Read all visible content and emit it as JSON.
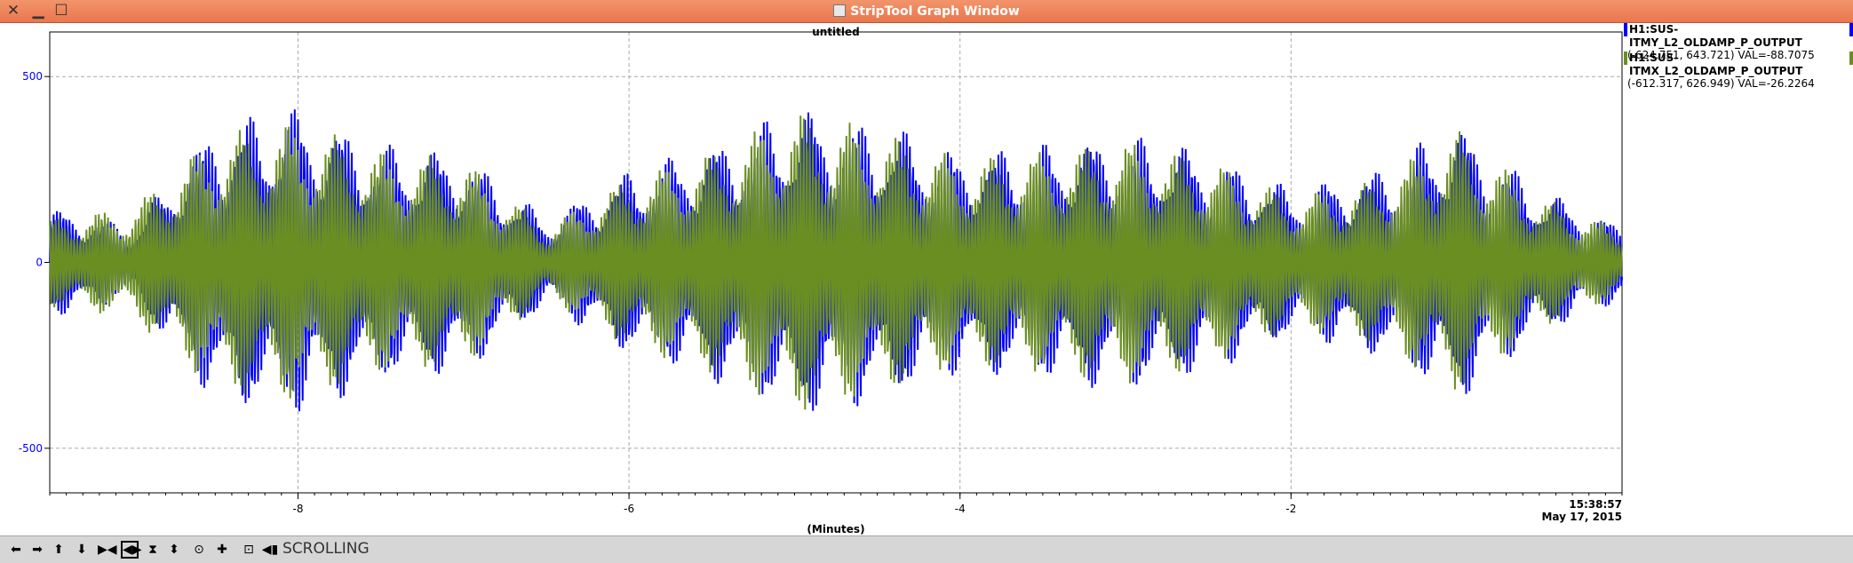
{
  "window": {
    "title": "StripTool Graph Window"
  },
  "graph": {
    "title": "untitled",
    "xlabel": "(Minutes)",
    "timestamp": {
      "time": "15:38:57",
      "date": "May 17, 2015"
    },
    "y_ticks": [
      "500",
      "0",
      "-500"
    ],
    "x_ticks": [
      "-8",
      "-6",
      "-4",
      "-2"
    ]
  },
  "legend": [
    {
      "name": "H1:SUS-ITMY_L2_OLDAMP_P_OUTPUT",
      "range": "(-624.751, 643.721) VAL=-88.7075",
      "color": "#0000ff"
    },
    {
      "name": "H1:SUS-ITMX_L2_OLDAMP_P_OUTPUT",
      "range": "(-612.317, 626.949) VAL=-26.2264",
      "color": "#6b8e23"
    }
  ],
  "toolbar": {
    "mode_label": "SCROLLING"
  },
  "chart_data": {
    "type": "line",
    "title": "untitled",
    "xlabel": "(Minutes)",
    "ylabel": "",
    "xlim": [
      -9.5,
      0
    ],
    "ylim": [
      -620,
      620
    ],
    "grid": true,
    "series": [
      {
        "name": "H1:SUS-ITMY_L2_OLDAMP_P_OUTPUT",
        "color": "#0000ff",
        "envelope": {
          "x": [
            -9.5,
            -9.0,
            -8.5,
            -8.0,
            -7.5,
            -7.0,
            -6.5,
            -6.0,
            -5.5,
            -5.0,
            -4.5,
            -4.0,
            -3.5,
            -3.0,
            -2.5,
            -2.0,
            -1.5,
            -1.0,
            -0.5,
            0.0
          ],
          "y": [
            150,
            100,
            380,
            420,
            320,
            300,
            120,
            250,
            320,
            420,
            380,
            300,
            320,
            350,
            300,
            200,
            250,
            380,
            200,
            100
          ]
        }
      },
      {
        "name": "H1:SUS-ITMX_L2_OLDAMP_P_OUTPUT",
        "color": "#6b8e23",
        "envelope": {
          "x": [
            -9.5,
            -9.0,
            -8.5,
            -8.0,
            -7.5,
            -7.0,
            -6.5,
            -6.0,
            -5.5,
            -5.0,
            -4.5,
            -4.0,
            -3.5,
            -3.0,
            -2.5,
            -2.0,
            -1.5,
            -1.0,
            -0.5,
            0.0
          ],
          "y": [
            120,
            150,
            350,
            380,
            300,
            280,
            100,
            230,
            300,
            410,
            360,
            280,
            300,
            330,
            280,
            180,
            220,
            360,
            180,
            90
          ]
        }
      }
    ]
  }
}
